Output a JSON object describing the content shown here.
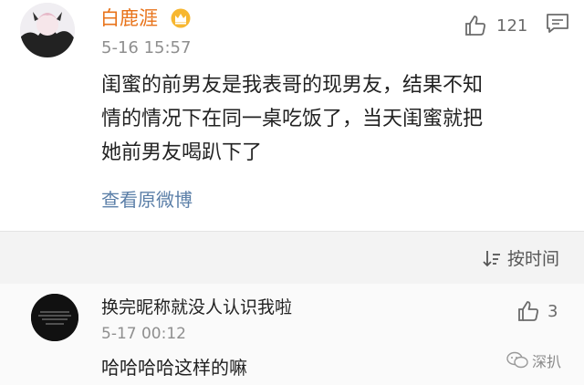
{
  "post": {
    "username": "白鹿涯",
    "timestamp": "5-16 15:57",
    "like_count": "121",
    "content_lines": [
      "闺蜜的前男友是我表哥的现男友，结果不知",
      "情的情况下在同一桌吃饭了，当天闺蜜就把",
      "她前男友喝趴下了"
    ],
    "view_original": "查看原微博"
  },
  "toolbar": {
    "sort_label": "按时间"
  },
  "reply": {
    "username": "换完昵称就没人认识我啦",
    "timestamp": "5-17 00:12",
    "like_count": "3",
    "content": "哈哈哈哈这样的嘛"
  },
  "watermark": {
    "label": "深扒"
  },
  "colors": {
    "username": "#e8731a",
    "link": "#5b7fa8",
    "meta": "#8f8f8f",
    "toolbar_bg": "#f3f3f3"
  }
}
